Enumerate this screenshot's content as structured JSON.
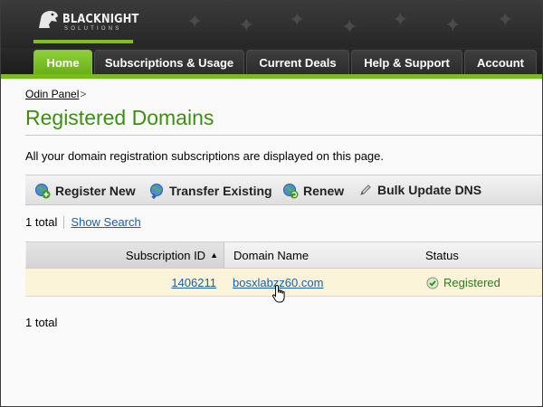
{
  "brand": {
    "name": "BLACKNIGHT",
    "tagline": "SOLUTIONS",
    "accent_color": "#7dc11f",
    "title_color": "#3c8f13",
    "link_color": "#1a5fa8"
  },
  "nav": {
    "tabs": [
      {
        "label": "Home",
        "active": true
      },
      {
        "label": "Subscriptions & Usage",
        "active": false
      },
      {
        "label": "Current Deals",
        "active": false
      },
      {
        "label": "Help & Support",
        "active": false
      },
      {
        "label": "Account",
        "active": false
      }
    ]
  },
  "breadcrumb": {
    "link": "Odin Panel",
    "separator": ">"
  },
  "page": {
    "title": "Registered Domains",
    "description": "All your domain registration subscriptions are displayed on this page."
  },
  "toolbar": {
    "buttons": [
      {
        "label": "Register New",
        "icon": "globe-add-icon"
      },
      {
        "label": "Transfer Existing",
        "icon": "globe-transfer-icon"
      },
      {
        "label": "Renew",
        "icon": "globe-renew-icon"
      },
      {
        "label": "Bulk Update DNS",
        "icon": "pencil-icon"
      }
    ]
  },
  "list": {
    "total_top": "1 total",
    "show_search": "Show Search",
    "total_bottom": "1 total",
    "columns": {
      "subscription_id": "Subscription ID",
      "domain_name": "Domain Name",
      "status": "Status"
    },
    "sort_indicator": "▲",
    "rows": [
      {
        "subscription_id": "1406211",
        "domain_name": "bosxlabzz60.com",
        "status": "Registered"
      }
    ]
  }
}
